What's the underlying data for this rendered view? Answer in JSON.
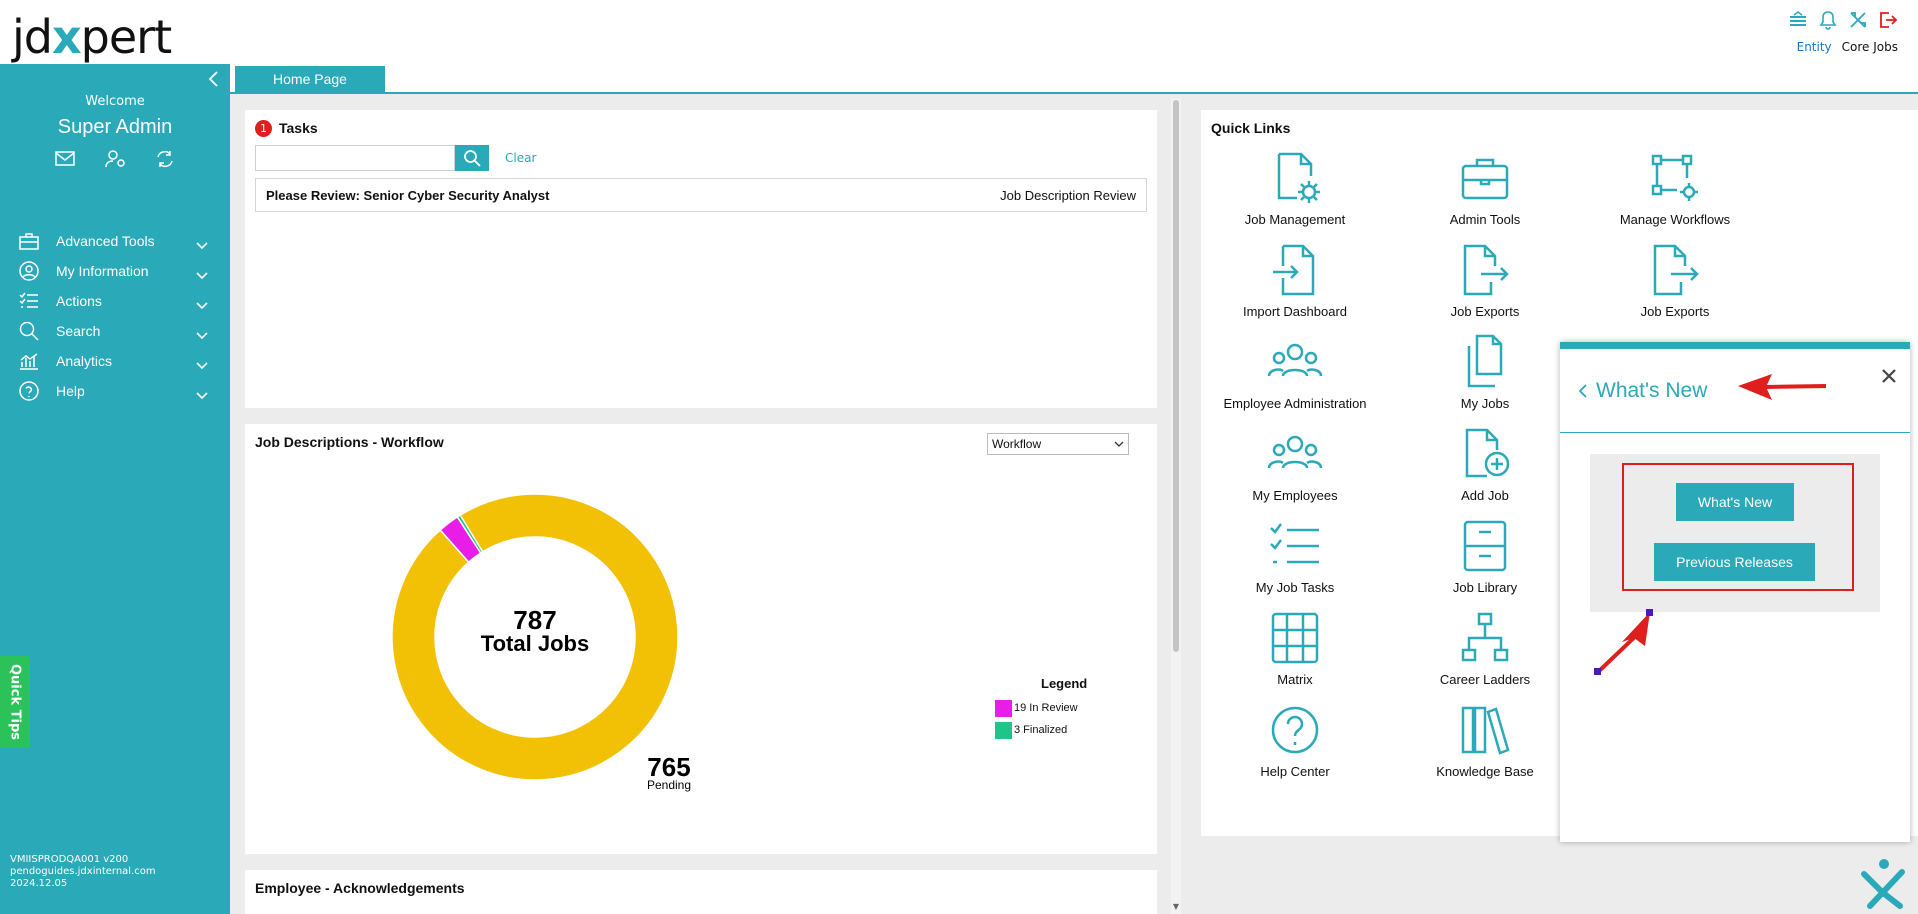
{
  "app": {
    "logo": {
      "pre": "jd",
      "x": "x",
      "post": "pert"
    },
    "top_links": {
      "entity": "Entity",
      "core_jobs": "Core Jobs"
    }
  },
  "sidebar": {
    "welcome": "Welcome",
    "user_name": "Super Admin",
    "items": [
      {
        "label": "Advanced Tools",
        "icon": "briefcase-icon"
      },
      {
        "label": "My Information",
        "icon": "user-circle-icon"
      },
      {
        "label": "Actions",
        "icon": "checklist-icon"
      },
      {
        "label": "Search",
        "icon": "search-icon"
      },
      {
        "label": "Analytics",
        "icon": "analytics-icon"
      },
      {
        "label": "Help",
        "icon": "help-icon"
      }
    ],
    "quick_tips": "Quick Tips",
    "version": {
      "server": "VMIISPRODQA001 v200",
      "host": "pendoguides.jdxinternal.com",
      "date": "2024.12.05"
    }
  },
  "tabs": [
    {
      "label": "Home Page"
    }
  ],
  "tasks": {
    "title": "Tasks",
    "badge_count": "1",
    "search_value": "",
    "clear_label": "Clear",
    "rows": [
      {
        "name": "Please Review: Senior Cyber Security Analyst",
        "type": "Job Description Review"
      }
    ]
  },
  "job_descriptions": {
    "title": "Job Descriptions - Workflow",
    "select_value": "Workflow",
    "center_total": "787",
    "center_label": "Total Jobs",
    "pending_value": "765",
    "pending_label": "Pending",
    "legend_title": "Legend",
    "legend": [
      {
        "label": "19 In Review",
        "color": "#e81ee8"
      },
      {
        "label": "3 Finalized",
        "color": "#1fc48a"
      }
    ]
  },
  "chart_data": {
    "type": "pie",
    "variant": "donut",
    "categories": [
      "Pending",
      "In Review",
      "Finalized"
    ],
    "values": [
      765,
      19,
      3
    ],
    "colors": [
      "#f2c106",
      "#e81ee8",
      "#1fc48a"
    ],
    "total": 787
  },
  "acknowledgements": {
    "title": "Employee - Acknowledgements"
  },
  "quick_links": {
    "title": "Quick Links",
    "items": [
      {
        "label": "Job Management",
        "icon": "job-management-icon"
      },
      {
        "label": "Admin Tools",
        "icon": "admin-tools-icon"
      },
      {
        "label": "Manage Workflows",
        "icon": "manage-workflows-icon"
      },
      {
        "label": "Import Dashboard",
        "icon": "import-dashboard-icon"
      },
      {
        "label": "Job Exports",
        "icon": "job-exports-icon"
      },
      {
        "label": "Job Exports",
        "icon": "job-exports-icon"
      },
      {
        "label": "Employee Administration",
        "icon": "employee-admin-icon"
      },
      {
        "label": "My Jobs",
        "icon": "my-jobs-icon"
      },
      {
        "label": "My Employees",
        "icon": "my-employees-icon"
      },
      {
        "label": "Add Job",
        "icon": "add-job-icon"
      },
      {
        "label": "My Job Tasks",
        "icon": "my-job-tasks-icon"
      },
      {
        "label": "Job Library",
        "icon": "job-library-icon"
      },
      {
        "label": "Matrix",
        "icon": "matrix-icon"
      },
      {
        "label": "Career Ladders",
        "icon": "career-ladders-icon"
      },
      {
        "label": "Help Center",
        "icon": "help-center-icon"
      },
      {
        "label": "Knowledge Base",
        "icon": "knowledge-base-icon"
      }
    ]
  },
  "whats_new": {
    "title": "What's New",
    "button_whats_new": "What's New",
    "button_previous": "Previous Releases"
  },
  "colors": {
    "accent": "#2aa9b8",
    "highlight": "#e01e1e"
  }
}
